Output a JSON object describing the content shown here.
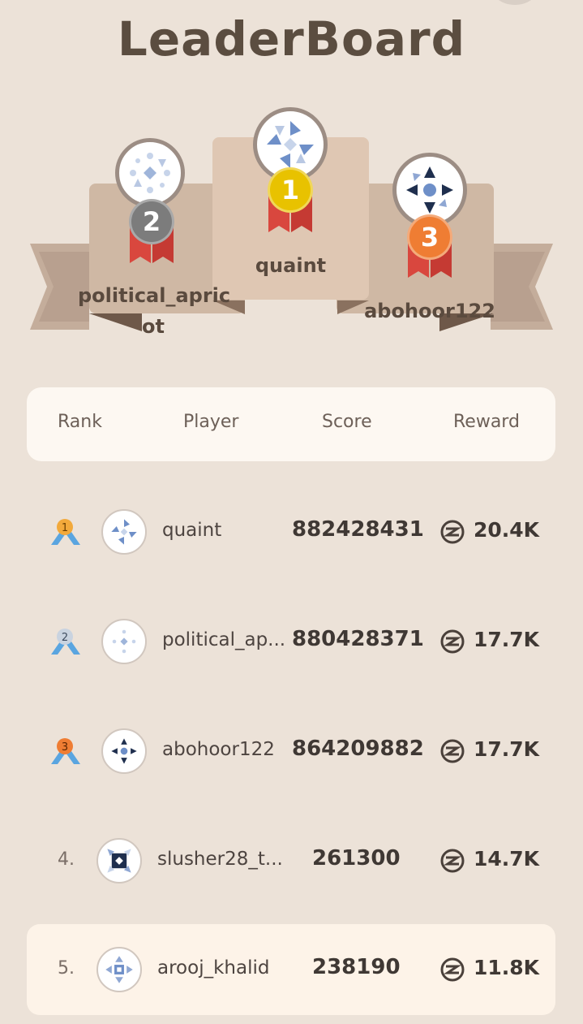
{
  "header": {
    "title": "LeaderBoard"
  },
  "podium": {
    "first": {
      "rank": "1",
      "name": "quaint",
      "badge_color": "#e8c200"
    },
    "second": {
      "rank": "2",
      "name_line1": "political_apric",
      "name_line2": "ot",
      "badge_color": "#7c7c7c"
    },
    "third": {
      "rank": "3",
      "name": "abohoor122",
      "badge_color": "#ef7d33"
    }
  },
  "table": {
    "columns": [
      "Rank",
      "Player",
      "Score",
      "Reward"
    ],
    "rows": [
      {
        "rank": "1",
        "name": "quaint",
        "score": "882428431",
        "reward": "20.4K",
        "rank_icon": "gold-rank-icon"
      },
      {
        "rank": "2",
        "name": "political_ap...",
        "score": "880428371",
        "reward": "17.7K",
        "rank_icon": "silver-rank-icon"
      },
      {
        "rank": "3",
        "name": "abohoor122",
        "score": "864209882",
        "reward": "17.7K",
        "rank_icon": "bronze-rank-icon"
      },
      {
        "rank": "4.",
        "name": "slusher28_t...",
        "score": "261300",
        "reward": "14.7K"
      },
      {
        "rank": "5.",
        "name": "arooj_khalid",
        "score": "238190",
        "reward": "11.8K"
      }
    ]
  },
  "colors": {
    "background": "#ece2d8",
    "gold": "#e8c200",
    "silver": "#7c7c7c",
    "bronze": "#ef7d33",
    "ribbon_red": "#d9473e"
  }
}
